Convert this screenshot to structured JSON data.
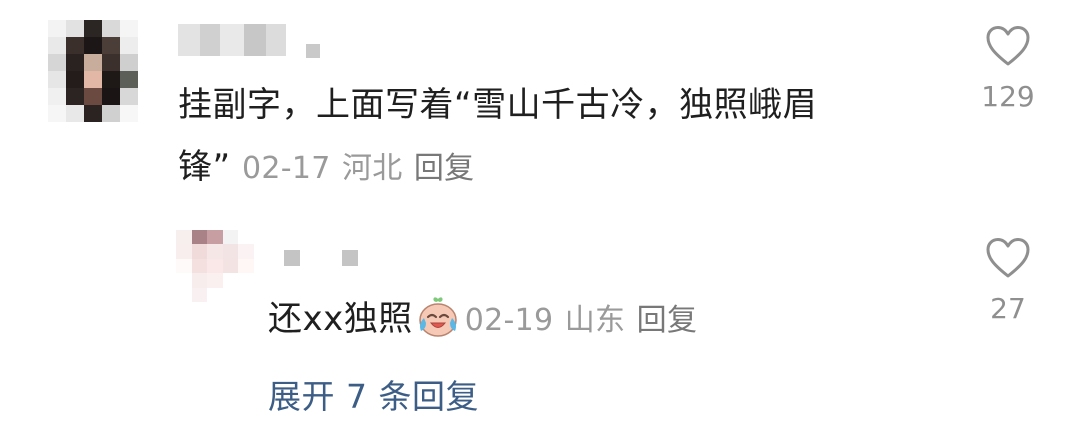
{
  "comments": {
    "main": {
      "text_line1": "挂副字，上面写着“雪山千古冷，独照峨眉",
      "text_line2": "锋”",
      "date": "02-17",
      "location": "河北",
      "reply_label": "回复",
      "likes": "129"
    },
    "reply": {
      "text": "还xx独照",
      "emoji": "crying-laughing-face-icon",
      "date": "02-19",
      "location": "山东",
      "reply_label": "回复",
      "likes": "27"
    },
    "expand_label": "展开 7 条回复"
  },
  "colors": {
    "text": "#1f1f1f",
    "meta": "#9a9a9a",
    "link": "#3c5d85",
    "heart_outline": "#8f8f8f"
  }
}
